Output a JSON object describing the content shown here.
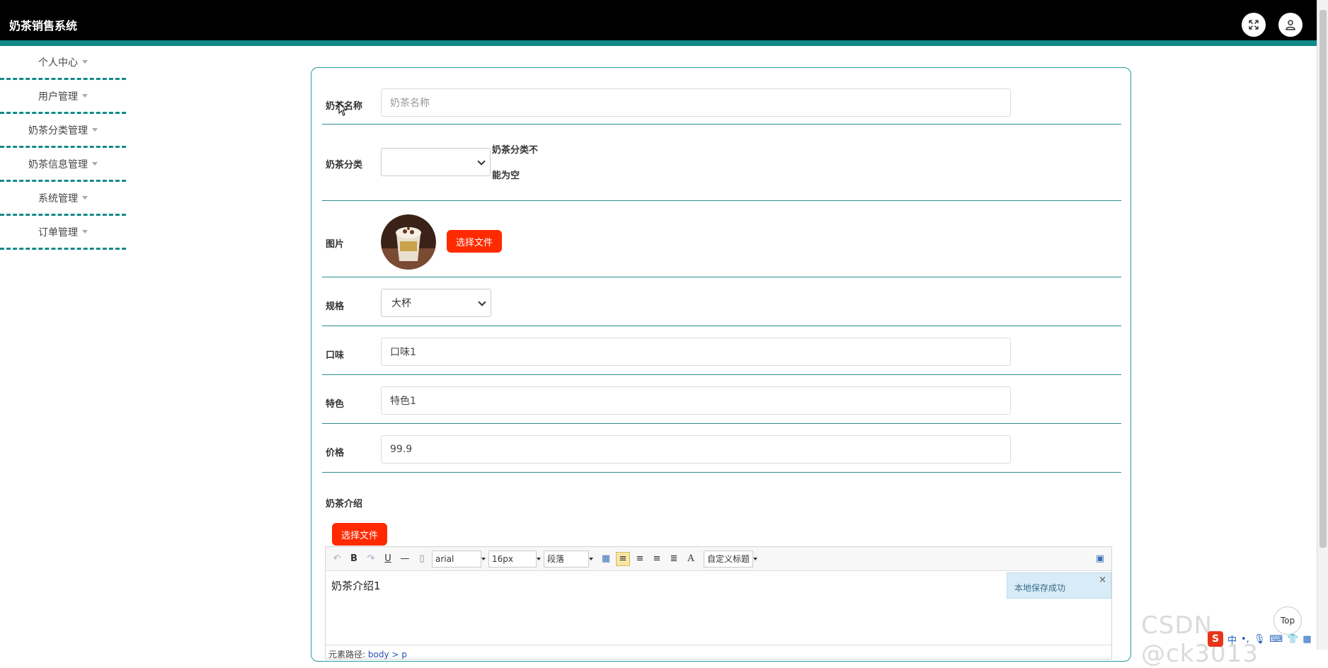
{
  "header": {
    "app_title": "奶茶销售系统",
    "icons": [
      "expand-icon",
      "user-icon"
    ]
  },
  "sidebar": {
    "items": [
      {
        "label": "个人中心"
      },
      {
        "label": "用户管理"
      },
      {
        "label": "奶茶分类管理"
      },
      {
        "label": "奶茶信息管理"
      },
      {
        "label": "系统管理"
      },
      {
        "label": "订单管理"
      }
    ]
  },
  "form": {
    "name": {
      "label": "奶茶名称",
      "placeholder": "奶茶名称",
      "value": ""
    },
    "category": {
      "label": "奶茶分类",
      "value": "",
      "error_line1": "奶茶分类不",
      "error_line2": "能为空"
    },
    "image": {
      "label": "图片",
      "button": "选择文件"
    },
    "spec": {
      "label": "规格",
      "value": "大杯"
    },
    "flavor": {
      "label": "口味",
      "value": "口味1"
    },
    "feature": {
      "label": "特色",
      "value": "特色1"
    },
    "price": {
      "label": "价格",
      "value": "99.9"
    },
    "intro": {
      "label": "奶茶介绍",
      "button": "选择文件"
    }
  },
  "editor": {
    "font_family": "arial",
    "font_size": "16px",
    "paragraph": "段落",
    "custom_title": "自定义标题",
    "content": "奶茶介绍1",
    "toast": "本地保存成功",
    "path_label": "元素路径:",
    "path_value": "body > p"
  },
  "misc": {
    "watermark": "CSDN @ck3013",
    "top_button": "Top",
    "ime_label": "中"
  },
  "colors": {
    "accent": "#0f8a8a",
    "danger_button": "#ff2a00",
    "header_bg": "#000000"
  }
}
